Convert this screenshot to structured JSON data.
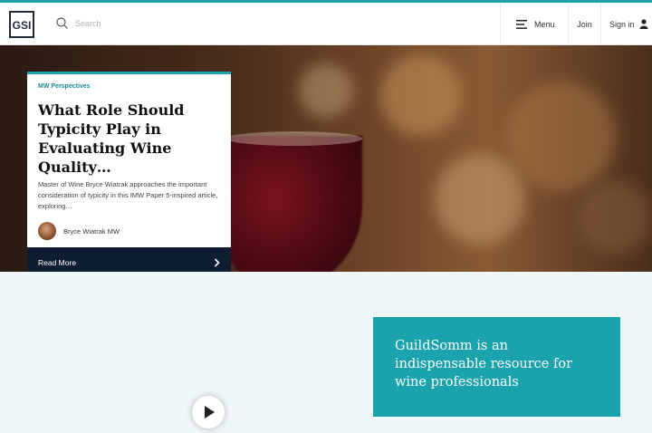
{
  "header": {
    "logo_text": "GSI",
    "search_placeholder": "Search",
    "menu_label": "Menu",
    "join_label": "Join",
    "signin_label": "Sign in"
  },
  "feature_card": {
    "tag": "MW Perspectives",
    "title": "What Role Should Typicity Play in Evaluating Wine Quality…",
    "description": "Master of Wine Bryce Wiatrak approaches the important consideration of typicity in this IMW Paper 5-inspired article, exploring…",
    "author": "Bryce Wiatrak MW",
    "cta": "Read More"
  },
  "promo": {
    "headline": "GuildSomm is an indispensable resource for wine professionals"
  },
  "colors": {
    "accent": "#1aa3ad",
    "navy": "#0f1d33"
  }
}
